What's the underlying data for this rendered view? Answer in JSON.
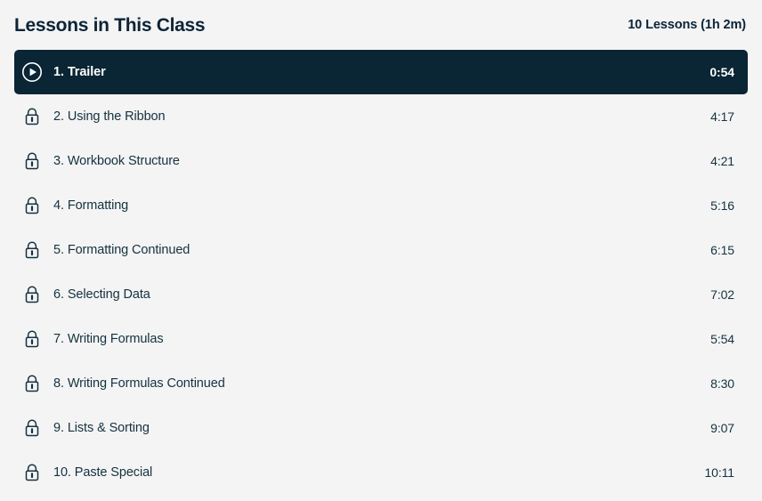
{
  "header": {
    "title": "Lessons in This Class",
    "meta": "10 Lessons (1h 2m)"
  },
  "colors": {
    "page_background": "#f4f4f5",
    "active_row_background": "#0a2534",
    "text_primary": "#14323f",
    "text_heading": "#0c2436",
    "active_text": "#ffffff"
  },
  "lessons": [
    {
      "title": "1. Trailer",
      "duration": "0:54",
      "icon": "play-circle-icon",
      "state": "active",
      "locked": false
    },
    {
      "title": "2. Using the Ribbon",
      "duration": "4:17",
      "icon": "lock-icon",
      "state": "locked",
      "locked": true
    },
    {
      "title": "3. Workbook Structure",
      "duration": "4:21",
      "icon": "lock-icon",
      "state": "locked",
      "locked": true
    },
    {
      "title": "4. Formatting",
      "duration": "5:16",
      "icon": "lock-icon",
      "state": "locked",
      "locked": true
    },
    {
      "title": "5. Formatting Continued",
      "duration": "6:15",
      "icon": "lock-icon",
      "state": "locked",
      "locked": true
    },
    {
      "title": "6. Selecting Data",
      "duration": "7:02",
      "icon": "lock-icon",
      "state": "locked",
      "locked": true
    },
    {
      "title": "7. Writing Formulas",
      "duration": "5:54",
      "icon": "lock-icon",
      "state": "locked",
      "locked": true
    },
    {
      "title": "8. Writing Formulas Continued",
      "duration": "8:30",
      "icon": "lock-icon",
      "state": "locked",
      "locked": true
    },
    {
      "title": "9. Lists & Sorting",
      "duration": "9:07",
      "icon": "lock-icon",
      "state": "locked",
      "locked": true
    },
    {
      "title": "10. Paste Special",
      "duration": "10:11",
      "icon": "lock-icon",
      "state": "locked",
      "locked": true
    }
  ]
}
